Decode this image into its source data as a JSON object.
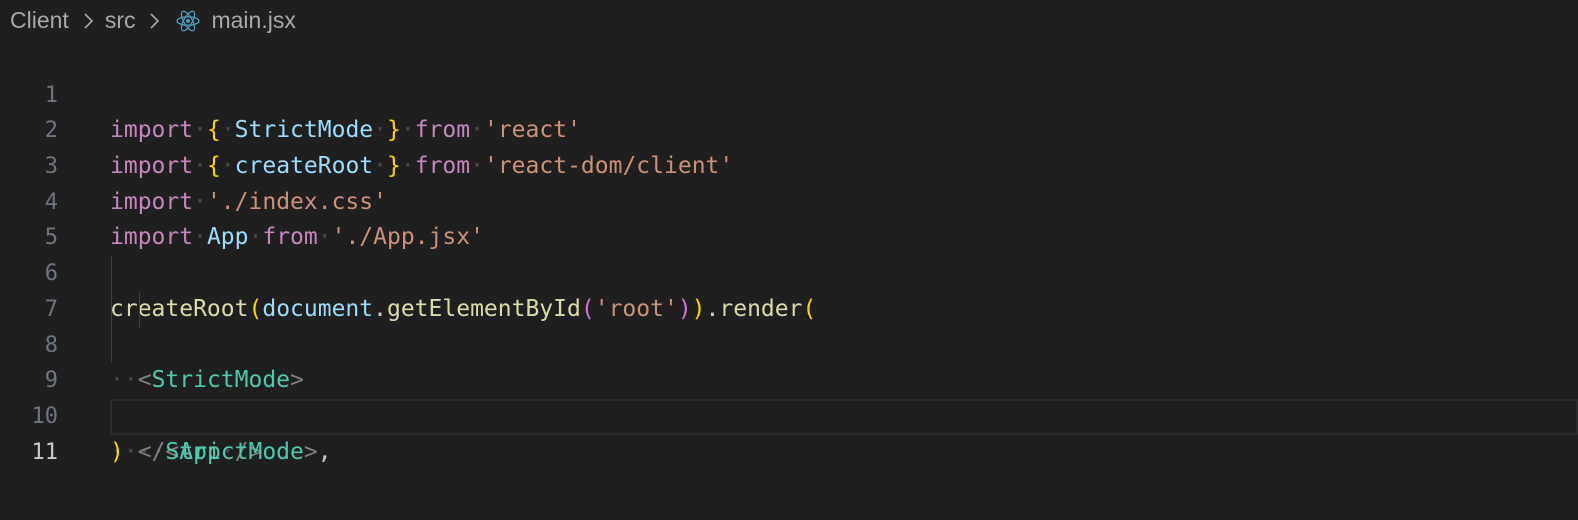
{
  "breadcrumb": {
    "items": [
      "Client",
      "src",
      "main.jsx"
    ]
  },
  "editor": {
    "line_numbers": [
      "1",
      "2",
      "3",
      "4",
      "5",
      "6",
      "7",
      "8",
      "9",
      "10",
      "11"
    ],
    "active_line": "11",
    "tokens": {
      "import": "import",
      "from": "from",
      "open_brace": "{",
      "close_brace": "}",
      "StrictMode": "StrictMode",
      "createRoot": "createRoot",
      "str_react": "'react'",
      "str_react_dom": "'react-dom/client'",
      "str_index_css": "'./index.css'",
      "App": "App",
      "str_app_jsx": "'./App.jsx'",
      "document": "document",
      "dot": ".",
      "getElementById": "getElementById",
      "paren_open": "(",
      "paren_close": ")",
      "str_root": "'root'",
      "render": "render",
      "lt": "<",
      "gt": ">",
      "lt_slash": "</",
      "self_close": "/>",
      "comma": ",",
      "dot_ws": "·",
      "dots2": "··"
    }
  },
  "colors": {
    "background": "#1f1f1f",
    "keyword": "#c586c0",
    "bracket_gold": "#ffd700",
    "bracket_orchid": "#da70d6",
    "bracket_blue": "#179fff",
    "identifier": "#9cdcfe",
    "string": "#ce9178",
    "function": "#dcdcaa",
    "jsx_tag": "#4ec9b0"
  },
  "icons": {
    "separator": "chevron-right-icon",
    "file": "react-icon"
  }
}
